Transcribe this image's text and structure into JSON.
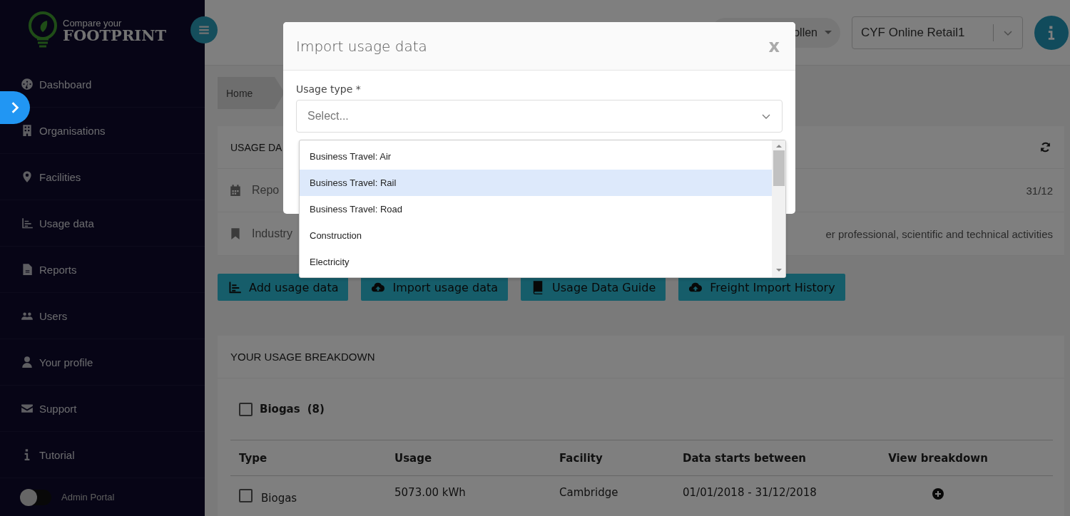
{
  "brand": {
    "line1": "Compare your",
    "line2": "FOOTPRINT"
  },
  "sidebar": {
    "items": [
      {
        "label": "Dashboard"
      },
      {
        "label": "Organisations"
      },
      {
        "label": "Facilities"
      },
      {
        "label": "Usage data"
      },
      {
        "label": "Reports"
      },
      {
        "label": "Users"
      },
      {
        "label": "Your profile"
      },
      {
        "label": "Support"
      },
      {
        "label": "Tutorial"
      }
    ],
    "admin_toggle": {
      "label": "Admin Portal",
      "on": false
    }
  },
  "header": {
    "user_name": "ollen",
    "organisation": "CYF Online Retail1"
  },
  "breadcrumb": [
    "Home"
  ],
  "summary": {
    "title": "USAGE DA",
    "rows": [
      {
        "label": "Repo",
        "value": "31/12"
      },
      {
        "label": "Industry",
        "value": "er professional, scientific and technical activities"
      }
    ]
  },
  "actions": [
    {
      "label": "Add usage data"
    },
    {
      "label": "Import usage data"
    },
    {
      "label": "Usage Data Guide"
    },
    {
      "label": "Freight Import History"
    }
  ],
  "breakdown": {
    "title": "YOUR USAGE BREAKDOWN",
    "group": {
      "label": "Biogas",
      "count": "(8)",
      "checked": false
    },
    "columns": [
      "Type",
      "Usage",
      "Facility",
      "Data starts between",
      "View breakdown"
    ],
    "rows": [
      {
        "type": "Biogas",
        "checked": false,
        "usage": "5073.00 kWh",
        "facility": "Cambridge",
        "dates": "01/01/2018 - 31/12/2018"
      }
    ]
  },
  "modal": {
    "title": "Import usage data",
    "close": "x",
    "field_label": "Usage type *",
    "placeholder": "Select...",
    "options": [
      {
        "label": "Business Travel: Air",
        "selected": false
      },
      {
        "label": "Business Travel: Rail",
        "selected": true
      },
      {
        "label": "Business Travel: Road",
        "selected": false
      },
      {
        "label": "Construction",
        "selected": false
      },
      {
        "label": "Electricity",
        "selected": false
      }
    ]
  }
}
